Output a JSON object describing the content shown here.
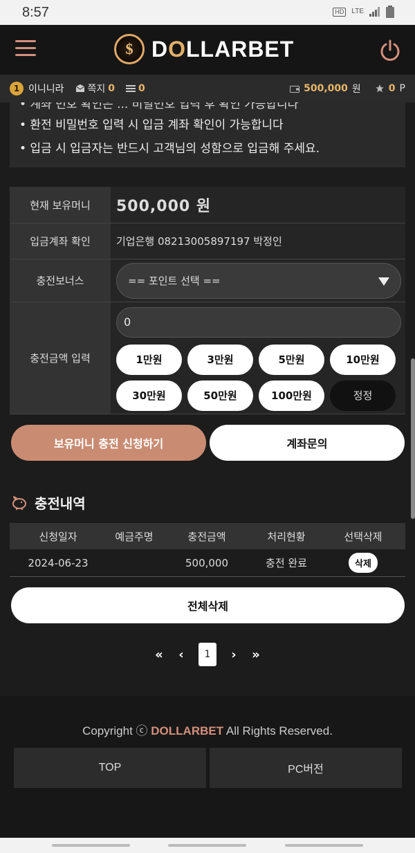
{
  "status": {
    "time": "8:57",
    "hd": "HD",
    "voice": "Voice",
    "lte": "LTE"
  },
  "header": {
    "logo_symbol": "$",
    "logo_text_1": "D",
    "logo_text_o": "O",
    "logo_text_2": "LLARBET"
  },
  "user": {
    "level": "1",
    "name": "이니니라",
    "memo_label": "쪽지",
    "memo_count": "0",
    "ticket_count": "0",
    "money": "500,000",
    "money_unit": "원",
    "points": "0",
    "points_unit": "P"
  },
  "notice": {
    "line_partial": "• 계좌 번호 확인은 ... 비밀번호 입력 후 확인 가능합니다",
    "line1": "• 환전 비밀번호 입력 시 입금 계좌 확인이 가능합니다",
    "line2": "• 입금 시 입금자는 반드시 고객님의 성함으로 입금해 주세요."
  },
  "form": {
    "balance_label": "현재 보유머니",
    "balance_value": "500,000 원",
    "account_label": "입금계좌 확인",
    "account_value": "기업은행 08213005897197 박정인",
    "bonus_label": "충전보너스",
    "bonus_select": "== 포인트 선택 ==",
    "amount_label": "충전금액 입력",
    "amount_value": "0",
    "chips": [
      "1만원",
      "3만원",
      "5만원",
      "10만원",
      "30만원",
      "50만원",
      "100만원",
      "정정"
    ]
  },
  "actions": {
    "apply": "보유머니 충전 신청하기",
    "inquiry": "계좌문의"
  },
  "history": {
    "title": "충전내역",
    "columns": [
      "신청일자",
      "예금주명",
      "충전금액",
      "처리현황",
      "선택삭제"
    ],
    "rows": [
      {
        "date": "2024-06-23",
        "holder": "",
        "amount": "500,000",
        "status": "충전 완료",
        "delete": "삭제"
      }
    ],
    "delete_all": "전체삭제"
  },
  "pager": {
    "first": "«",
    "prev": "‹",
    "current": "1",
    "next": "›",
    "last": "»"
  },
  "footer": {
    "copy_prefix": "Copyright ⓒ",
    "brand": "DOLLARBET",
    "copy_suffix": "All Rights Reserved.",
    "top": "TOP",
    "pc": "PC버전"
  },
  "colors": {
    "accent": "#c98c73",
    "gold": "#e6b66a",
    "bg": "#1c1c1c"
  }
}
